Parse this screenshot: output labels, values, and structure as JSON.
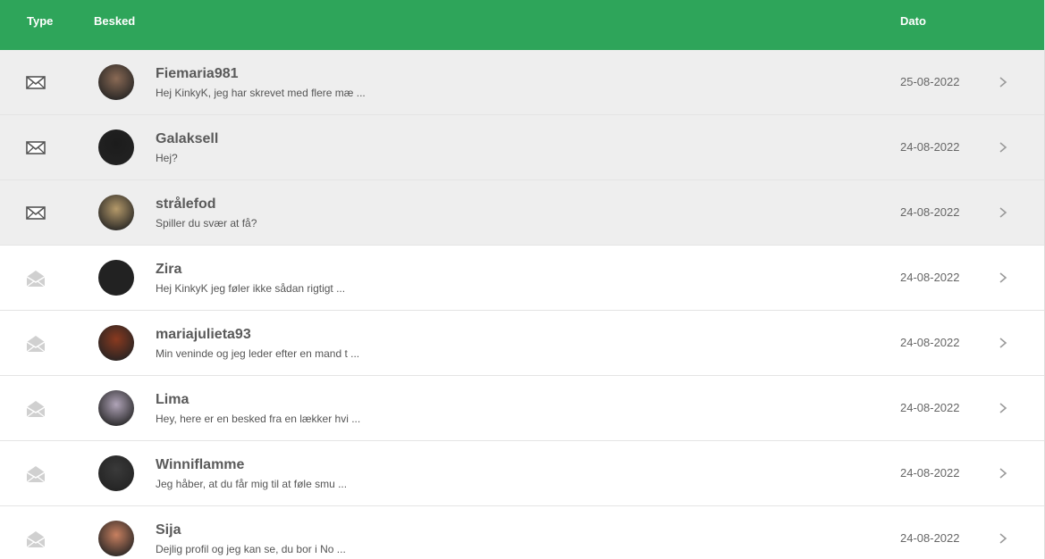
{
  "header": {
    "type_label": "Type",
    "message_label": "Besked",
    "date_label": "Dato"
  },
  "colors": {
    "header_bg": "#2ea55a",
    "unread_bg": "#eeeeee",
    "read_bg": "#ffffff"
  },
  "messages": [
    {
      "name": "Fiemaria981",
      "preview": "Hej KinkyK, jeg har skrevet med flere mæ ...",
      "date": "25-08-2022",
      "unread": true,
      "icon": "envelope-closed-icon"
    },
    {
      "name": "Galaksell",
      "preview": "Hej?",
      "date": "24-08-2022",
      "unread": true,
      "icon": "envelope-closed-icon"
    },
    {
      "name": "strålefod",
      "preview": "Spiller du svær at få?",
      "date": "24-08-2022",
      "unread": true,
      "icon": "envelope-closed-icon"
    },
    {
      "name": "Zira",
      "preview": "Hej KinkyK jeg føler ikke sådan rigtigt ...",
      "date": "24-08-2022",
      "unread": false,
      "icon": "envelope-open-icon"
    },
    {
      "name": "mariajulieta93",
      "preview": "Min veninde og jeg leder efter en mand t ...",
      "date": "24-08-2022",
      "unread": false,
      "icon": "envelope-open-icon"
    },
    {
      "name": "Lima",
      "preview": "Hey, here er en besked fra en lækker hvi ...",
      "date": "24-08-2022",
      "unread": false,
      "icon": "envelope-open-icon"
    },
    {
      "name": "Winniflamme",
      "preview": "Jeg håber, at du får mig til at føle smu ...",
      "date": "24-08-2022",
      "unread": false,
      "icon": "envelope-open-icon"
    },
    {
      "name": "Sija",
      "preview": "Dejlig profil og jeg kan se, du bor i No ...",
      "date": "24-08-2022",
      "unread": false,
      "icon": "envelope-open-icon"
    }
  ]
}
